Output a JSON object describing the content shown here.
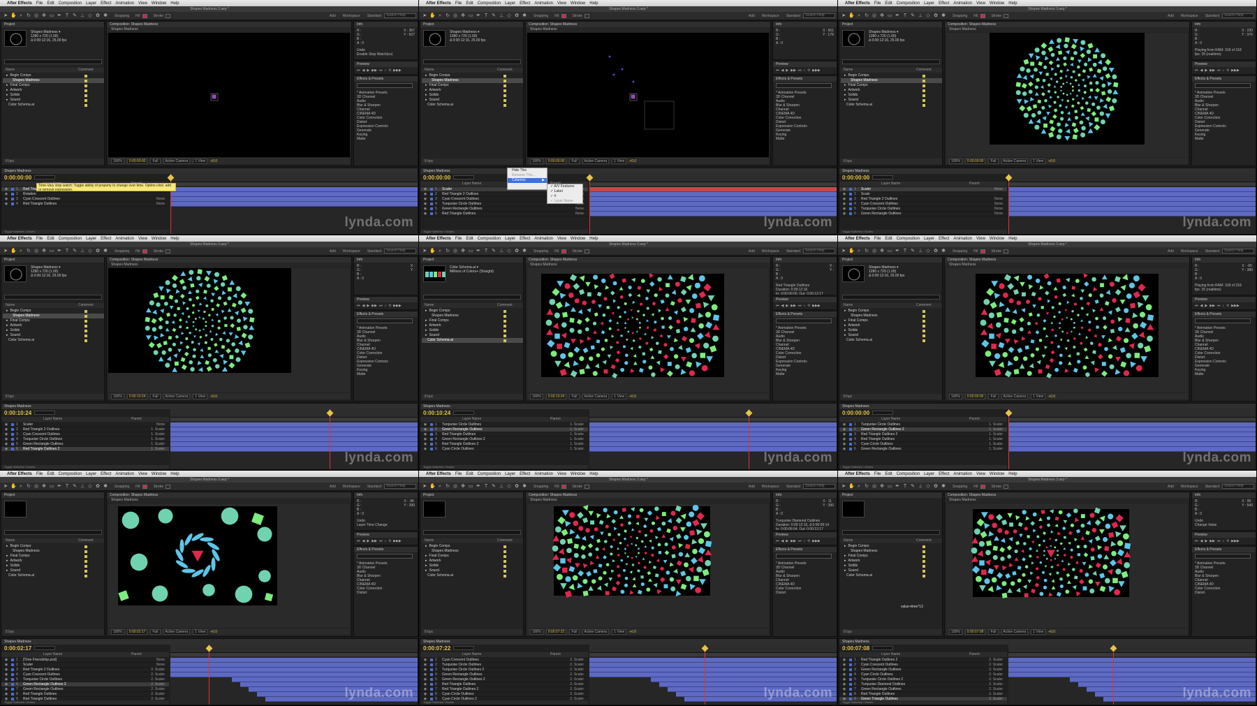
{
  "menubar": {
    "app_name": "After Effects",
    "menus": [
      "File",
      "Edit",
      "Composition",
      "Layer",
      "Effect",
      "Animation",
      "View",
      "Window",
      "Help"
    ]
  },
  "window_title": "Shapes Madness 3.aep *",
  "toolbar": {
    "snapping_label": "Snapping",
    "fill_label": "Fill",
    "stroke_label": "Stroke",
    "add_label": "Add",
    "workspace_label": "Workspace",
    "workspace_value": "Standard",
    "search_placeholder": "Search Help"
  },
  "project": {
    "tab_label": "Project",
    "selected_info": [
      "Shapes Madness ▾",
      "1280 x 720 (1.00)",
      "Δ 0:00:12:16, 25.00 fps"
    ],
    "alt_info": [
      "Color Schema.ai ▾",
      "Millions of Colors+ (Straight)"
    ],
    "columns": [
      "Name",
      "Comment"
    ],
    "items": [
      "Begin Comps",
      "Shapes Madness",
      "Final Comps",
      "Artwork",
      "Solids",
      "Sound",
      "Color Schema.ai"
    ],
    "footer": "8 bpc"
  },
  "composition": {
    "tab_label": "Composition: Shapes Madness",
    "sub_tab": "Shapes Madness",
    "zoom": "100%",
    "resolution": "Full",
    "camera": "Active Camera",
    "views": "1 View",
    "exposure": "+0.0"
  },
  "info_panel": {
    "tab_label": "Info",
    "channels": [
      "R :",
      "G :",
      "B :",
      "A : 0"
    ]
  },
  "preview_panel": {
    "tab_label": "Preview"
  },
  "effects_panel": {
    "tab_label": "Effects & Presets",
    "items": [
      "* Animation Presets",
      "3D Channel",
      "Audio",
      "Blur & Sharpen",
      "Channel",
      "CINEMA 4D",
      "Color Correction",
      "Distort",
      "Expression Controls",
      "Generate",
      "Keying",
      "Matte"
    ]
  },
  "timeline": {
    "tab_label": "Shapes Madness",
    "columns": [
      "Layer Name",
      "Parent"
    ],
    "footer": "Toggle Switches / Modes"
  },
  "tiles": [
    {
      "timecode": "0:00:00:00",
      "info_text": [
        "Undo",
        "Enable Stop Watch(es)"
      ],
      "cursor_readout": [
        "X : 367",
        "Y : 507"
      ],
      "layers": [
        "Red Triangle 2 Outlines",
        "Rotation",
        "Cyan Crescent Outlines",
        "Red Triangle Outlines"
      ],
      "parents": [
        "None",
        "",
        "None",
        "None"
      ],
      "selected": 0
    },
    {
      "timecode": "0:00:00:00",
      "info_text": [],
      "cursor_readout": [
        "X : 561",
        "Y : 178"
      ],
      "layers": [
        "Scaler",
        "Red Triangle 2 Outlines",
        "Cyan Crescent Outlines",
        "Turquoise Circle Outlines",
        "Green Rectangle Outlines",
        "Red Triangle Outlines"
      ],
      "parents": [
        "None",
        "None",
        "None",
        "None",
        "None",
        "None"
      ],
      "selected": 0
    },
    {
      "timecode": "0:00:00:00",
      "info_text": [
        "Playing from RAM: 318 of 318",
        "fps: 25 (realtime)"
      ],
      "cursor_readout": [
        "X : 230",
        "Y : 376"
      ],
      "layers": [
        "Scaler",
        "Scale",
        "Red Triangle 2 Outlines",
        "Cyan Crescent Outlines",
        "Turquoise Circle Outlines",
        "Green Rectangle Outlines"
      ],
      "parents": [
        "None",
        "",
        "None",
        "None",
        "None",
        "None"
      ],
      "selected": 0
    },
    {
      "timecode": "0:00:10:24",
      "info_text": [],
      "cursor_readout": [
        "X :",
        "Y :"
      ],
      "layers": [
        "Scaler",
        "Red Triangle 2 Outlines",
        "Cyan Crescent Outlines",
        "Turquoise Circle Outlines",
        "Green Rectangle Outlines",
        "Red Triangle Outlines 2"
      ],
      "parents": [
        "None",
        "1. Scaler",
        "1. Scaler",
        "1. Scaler",
        "1. Scaler",
        "1. Scaler"
      ],
      "selected": 5
    },
    {
      "timecode": "0:00:10:24",
      "info_text": [
        "Red Triangle Outlines",
        "Duration: 0:00:12:16",
        "In: 0:00:00:00, Out: 0:00:12:17"
      ],
      "cursor_readout": [
        "X :",
        "Y :"
      ],
      "layers": [
        "Turquoise Circle Outlines",
        "Green Rectangle Outlines",
        "Red Triangle Outlines",
        "Green Rectangle Outlines 2",
        "Red Triangle Outlines 2",
        "Cyan Circle Outlines"
      ],
      "parents": [
        "1. Scaler",
        "1. Scaler",
        "1. Scaler",
        "1. Scaler",
        "1. Scaler",
        "1. Scaler"
      ],
      "selected": 1
    },
    {
      "timecode": "0:00:00:00",
      "info_text": [
        "Playing from RAM: 318 of 318",
        "fps: 25 (realtime)"
      ],
      "cursor_readout": [
        "X : -66",
        "Y : 380"
      ],
      "layers": [
        "Turquoise Circle Outlines",
        "Green Rectangle Outlines 2",
        "Red Triangle Outlines 2",
        "Red Triangle Outlines",
        "Cyan Circle Outlines",
        "Green Rectangle Outlines"
      ],
      "parents": [
        "1. Scaler",
        "1. Scaler",
        "1. Scaler",
        "1. Scaler",
        "1. Scaler",
        "1. Scaler"
      ],
      "selected": 1
    },
    {
      "timecode": "0:00:02:17",
      "info_text": [
        "Undo",
        "Layer Time Change"
      ],
      "cursor_readout": [
        "X : -96",
        "Y : 390"
      ],
      "layers": [
        "[Time Friendship.psd]",
        "Scaler",
        "Red Triangle 2 Outlines",
        "Cyan Crescent Outlines",
        "Turquoise Circle Outlines",
        "Green Rectangle Outlines 2",
        "Green Rectangle Outlines",
        "Red Triangle Outlines",
        "Red Triangle Outlines"
      ],
      "parents": [
        "None",
        "None",
        "2. Scaler",
        "2. Scaler",
        "2. Scaler",
        "2. Scaler",
        "2. Scaler",
        "2. Scaler",
        "2. Scaler"
      ],
      "selected": 5
    },
    {
      "timecode": "0:00:07:22",
      "info_text": [
        "Turquoise Diamond Outlines",
        "Duration: 0:00:12:16, Δ 0:00:06:14",
        "In: 0:00:06:04, Out: 0:00:12:17"
      ],
      "cursor_readout": [
        "X : 11",
        "Y : 390"
      ],
      "layers": [
        "Cyan Crescent Outlines",
        "Turquoise Circle Outlines",
        "Turquoise Circle Outlines 2",
        "Green Rectangle Outlines",
        "Green Rectangle Outlines 2",
        "Red Triangle Outlines",
        "Red Triangle Outlines 2",
        "Cyan Circle Outlines",
        "Cyan Circle Outlines 2",
        "Turquoise Diamond Outlines"
      ],
      "parents": [
        "2. Scaler",
        "2. Scaler",
        "2. Scaler",
        "2. Scaler",
        "2. Scaler",
        "2. Scaler",
        "2. Scaler",
        "2. Scaler",
        "2. Scaler",
        "2. Scaler"
      ],
      "selected": 9
    },
    {
      "timecode": "0:00:07:08",
      "info_text": [
        "Undo",
        "Change Value"
      ],
      "cursor_readout": [
        "X : 99",
        "Y : 540"
      ],
      "layers": [
        "Red Triangle Outlines 2",
        "Cyan Crescent Outlines",
        "Green Rectangle Outlines",
        "Cyan Circle Outlines",
        "Turquoise Circle Outlines 2",
        "Turquoise Diamond Outlines",
        "Green Rectangle Outlines",
        "Red Triangle Outlines",
        "Green Triangle Outlines"
      ],
      "parents": [
        "2. Scaler",
        "2. Scaler",
        "2. Scaler",
        "2. Scaler",
        "2. Scaler",
        "2. Scaler",
        "2. Scaler",
        "2. Scaler",
        "2. Scaler"
      ],
      "selected": 8
    }
  ],
  "tooltip": "Time-Vary stop watch: Toggle ability of property to change over time. Option-click: add or remove expression.",
  "context_menu": {
    "items": [
      "Hide This",
      "Rename This...",
      "Columns"
    ],
    "submenu": [
      "✓ A/V Features",
      "✓ Label",
      "✓ #",
      "✓ Layer Name"
    ]
  },
  "value_edit": "value+time*13",
  "watermark": "lynda.com",
  "colors": {
    "turquoise": "#6fd3b0",
    "green": "#7dec7d",
    "cyan": "#5cc6e8",
    "red": "#e0284f",
    "layer_bar": "#5e6ac2",
    "timecode": "#e5c44a"
  }
}
